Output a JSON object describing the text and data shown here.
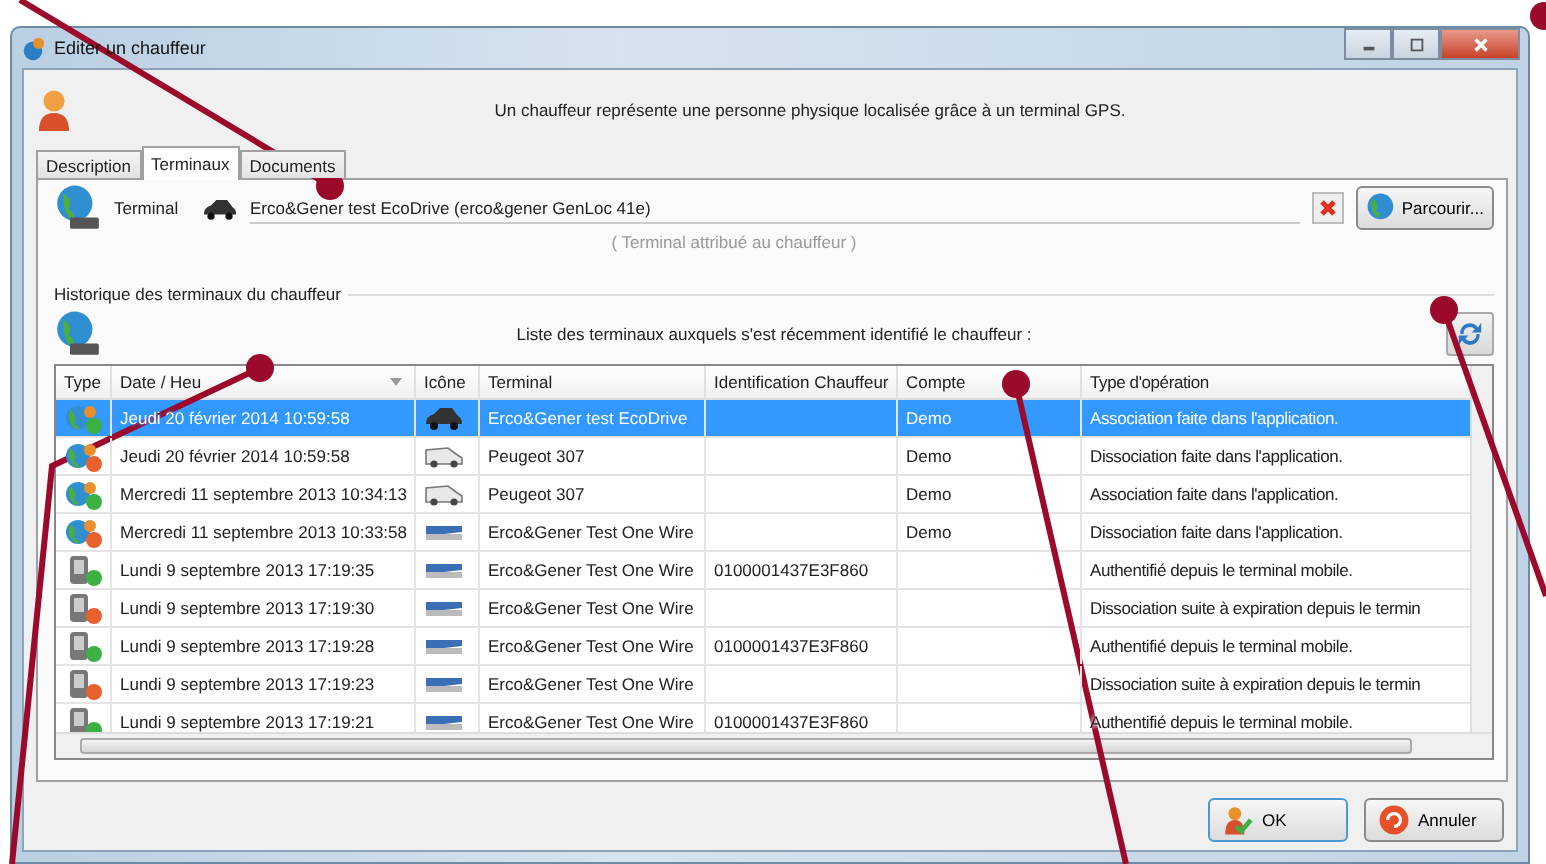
{
  "window": {
    "title": "Editer un chauffeur"
  },
  "intro": "Un chauffeur représente une personne physique localisée grâce à un terminal GPS.",
  "tabs": [
    {
      "label": "Description",
      "selected": false
    },
    {
      "label": "Terminaux",
      "selected": true
    },
    {
      "label": "Documents",
      "selected": false
    }
  ],
  "terminal": {
    "label": "Terminal",
    "value": "Erco&Gener test EcoDrive (erco&gener GenLoc 41e)",
    "hint": "( Terminal attribué au chauffeur )",
    "browse_button": "Parcourir..."
  },
  "history": {
    "title": "Historique des terminaux du chauffeur",
    "caption": "Liste des terminaux auxquels s'est récemment identifié le chauffeur :",
    "columns": [
      "Type",
      "Date / Heu",
      "Icône",
      "Terminal",
      "Identification Chauffeur",
      "Compte",
      "Type d'opération"
    ],
    "rows": [
      {
        "kind": "app-added",
        "terminal_icon": {
          "kind": "car"
        },
        "date": "Jeudi 20 février 2014 10:59:58",
        "terminal": "Erco&Gener test EcoDrive",
        "account": "Demo",
        "operation": "Association faite dans l'application.",
        "selected": true
      },
      {
        "kind": "app-removed",
        "terminal_icon": {
          "kind": "van"
        },
        "date": "Jeudi 20 février 2014 10:59:58",
        "terminal": "Peugeot 307",
        "account": "Demo",
        "operation": "Dissociation faite dans l'application.",
        "selected": false
      },
      {
        "kind": "app-added",
        "terminal_icon": {
          "kind": "van"
        },
        "date": "Mercredi 11 septembre 2013 10:34:13",
        "terminal": "Peugeot 307",
        "account": "Demo",
        "operation": "Association faite dans l'application.",
        "selected": false
      },
      {
        "kind": "app-removed",
        "terminal_icon": {
          "kind": "device"
        },
        "date": "Mercredi 11 septembre 2013 10:33:58",
        "terminal": "Erco&Gener Test One Wire",
        "account": "Demo",
        "operation": "Dissociation faite dans l'application.",
        "selected": false
      },
      {
        "kind": "mobile-added",
        "terminal_icon": {
          "kind": "device"
        },
        "date": "Lundi 9 septembre 2013 17:19:35",
        "terminal": "Erco&Gener Test One Wire",
        "identification": "0100001437E3F860",
        "operation": "Authentifié depuis le terminal mobile.",
        "selected": false
      },
      {
        "kind": "mobile-removed",
        "terminal_icon": {
          "kind": "device"
        },
        "date": "Lundi 9 septembre 2013 17:19:30",
        "terminal": "Erco&Gener Test One Wire",
        "operation": "Dissociation suite à expiration depuis le termin",
        "selected": false
      },
      {
        "kind": "mobile-added",
        "terminal_icon": {
          "kind": "device"
        },
        "date": "Lundi 9 septembre 2013 17:19:28",
        "terminal": "Erco&Gener Test One Wire",
        "identification": "0100001437E3F860",
        "operation": "Authentifié depuis le terminal mobile.",
        "selected": false
      },
      {
        "kind": "mobile-removed",
        "terminal_icon": {
          "kind": "device"
        },
        "date": "Lundi 9 septembre 2013 17:19:23",
        "terminal": "Erco&Gener Test One Wire",
        "operation": "Dissociation suite à expiration depuis le termin",
        "selected": false
      },
      {
        "kind": "mobile-added",
        "terminal_icon": {
          "kind": "device"
        },
        "date": "Lundi 9 septembre 2013 17:19:21",
        "terminal": "Erco&Gener Test One Wire",
        "identification": "0100001437E3F860",
        "operation": "Authentifié depuis le terminal mobile.",
        "selected": false
      }
    ]
  },
  "buttons": [
    {
      "label": "OK",
      "kind": "ok"
    },
    {
      "label": "Annuler",
      "kind": "cancel"
    }
  ]
}
